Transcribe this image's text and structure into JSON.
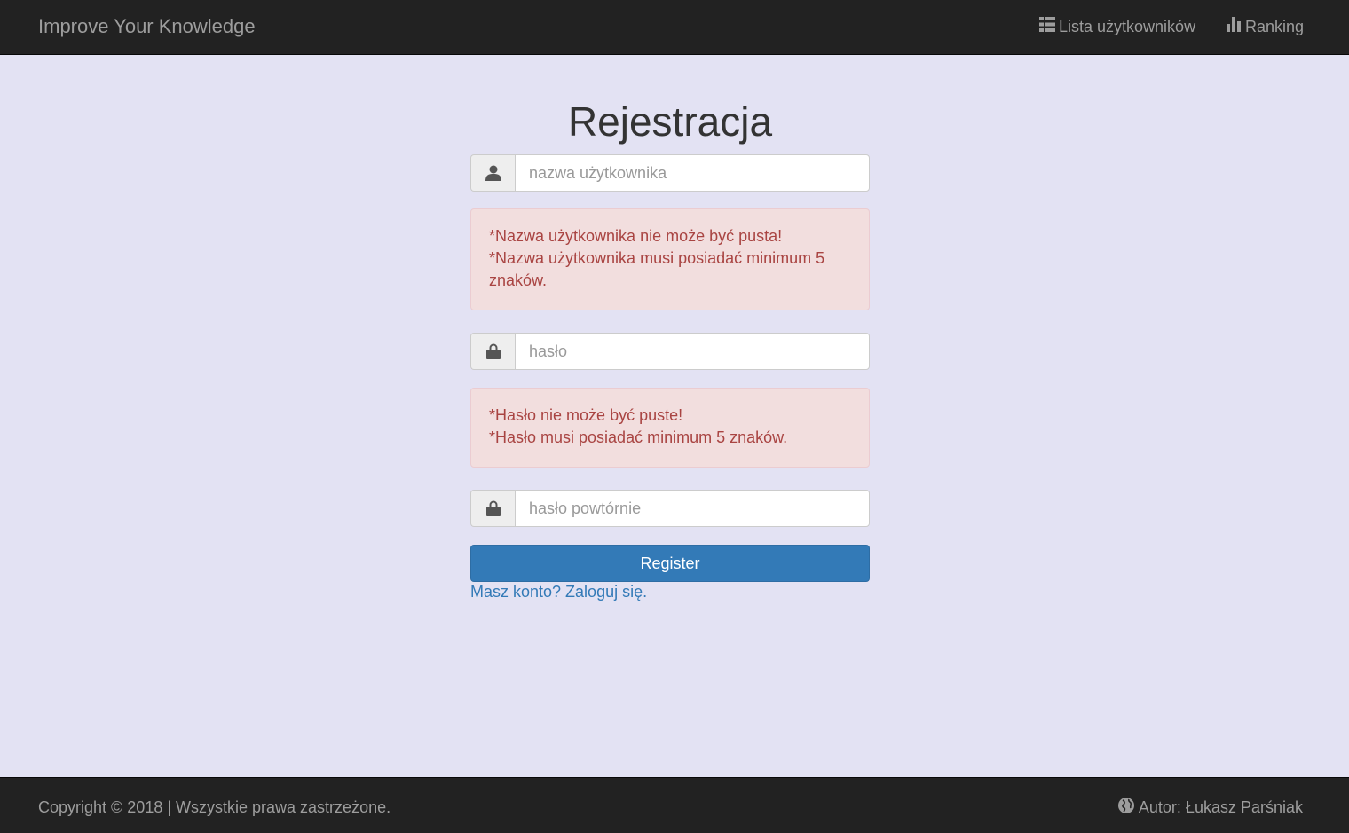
{
  "navbar": {
    "brand": "Improve Your Knowledge",
    "users_link": "Lista użytkowników",
    "ranking_link": "Ranking"
  },
  "form": {
    "title": "Rejestracja",
    "username_placeholder": "nazwa użytkownika",
    "username_errors": [
      "*Nazwa użytkownika nie może być pusta!",
      "*Nazwa użytkownika musi posiadać minimum 5 znaków."
    ],
    "password_placeholder": "hasło",
    "password_errors": [
      "*Hasło nie może być puste!",
      "*Hasło musi posiadać minimum 5 znaków."
    ],
    "password_repeat_placeholder": "hasło powtórnie",
    "register_button": "Register",
    "login_link": "Masz konto? Zaloguj się."
  },
  "footer": {
    "copyright": "Copyright © 2018 | Wszystkie prawa zastrzeżone.",
    "author": "Autor: Łukasz Parśniak"
  },
  "colors": {
    "navbar_bg": "#222222",
    "page_bg": "#e3e2f3",
    "primary": "#337ab7",
    "error_bg": "#f2dede",
    "error_text": "#a94442"
  },
  "icons": {
    "users_link": "list-icon",
    "ranking_link": "bar-chart-icon",
    "username": "user-icon",
    "password": "lock-icon",
    "password_repeat": "lock-icon",
    "author": "globe-icon"
  }
}
